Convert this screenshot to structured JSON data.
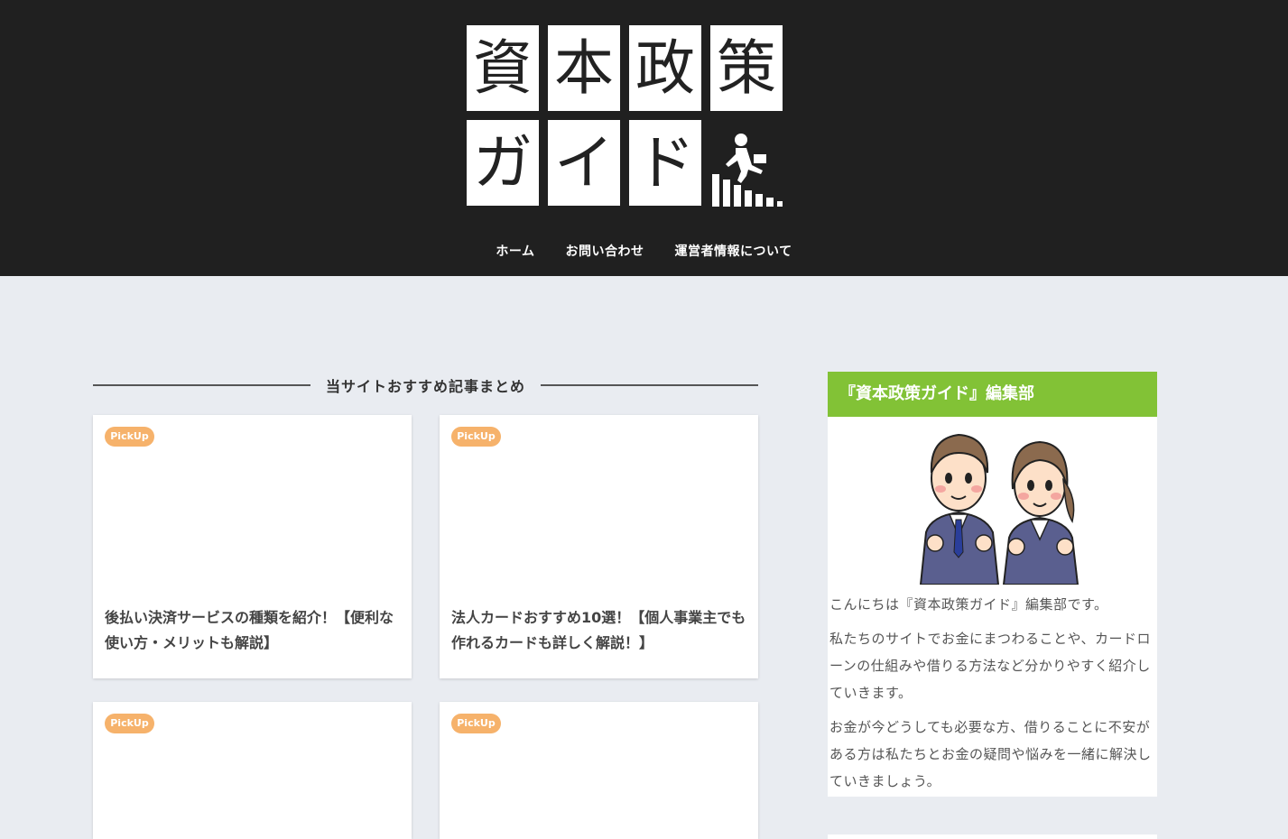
{
  "header": {
    "logo_chars_top": [
      "資",
      "本",
      "政",
      "策"
    ],
    "logo_chars_bottom": [
      "ガ",
      "イ",
      "ド"
    ],
    "logo_icon": "climbing-stairs-runner-icon",
    "background_color": "#202020"
  },
  "nav": {
    "items": [
      {
        "label": "ホーム"
      },
      {
        "label": "お問い合わせ"
      },
      {
        "label": "運営者情報について"
      }
    ]
  },
  "main": {
    "section_heading": "当サイトおすすめ記事まとめ",
    "cards": [
      {
        "badge": "PickUp",
        "title": "後払い決済サービスの種類を紹介！【便利な使い方・メリットも解説】"
      },
      {
        "badge": "PickUp",
        "title": "法人カードおすすめ10選！【個人事業主でも作れるカードも詳しく解説！】"
      },
      {
        "badge": "PickUp",
        "title": ""
      },
      {
        "badge": "PickUp",
        "title": ""
      }
    ],
    "badge_color": "#f6b26b"
  },
  "sidebar": {
    "widget_title": "『資本政策ガイド』編集部",
    "widget_title_color": "#82c236",
    "illustration": "two-business-people-illustration",
    "paragraphs": [
      "こんにちは『資本政策ガイド』編集部です。",
      "私たちのサイトでお金にまつわることや、カードローンの仕組みや借りる方法など分かりやすく紹介していきます。",
      "お金が今どうしても必要な方、借りることに不安がある方は私たちとお金の疑問や悩みを一緒に解決していきましょう。"
    ]
  }
}
